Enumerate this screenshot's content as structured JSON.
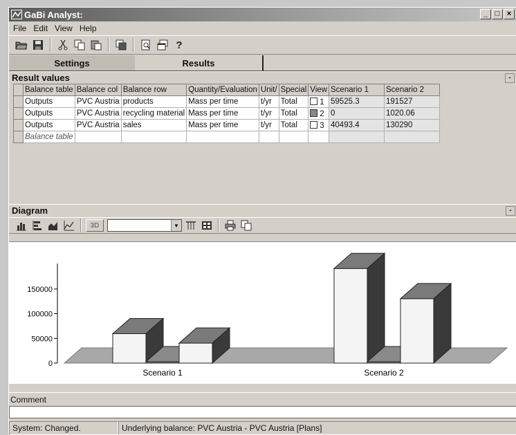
{
  "window": {
    "title": "GaBi Analyst:",
    "buttons": {
      "minimize": "_",
      "maximize": "□",
      "close": "×"
    }
  },
  "menu": {
    "items": [
      {
        "label": "File"
      },
      {
        "label": "Edit"
      },
      {
        "label": "View"
      },
      {
        "label": "Help"
      }
    ]
  },
  "toolbar": {
    "icons": [
      "open-icon",
      "save-icon",
      "cut-icon",
      "copy-icon",
      "paste-icon",
      "copy-window-icon",
      "print-preview-icon",
      "window-icon",
      "help-icon"
    ],
    "help_label": "?"
  },
  "tabs": [
    {
      "label": "Settings",
      "active": false
    },
    {
      "label": "Results",
      "active": true
    }
  ],
  "result_values": {
    "title": "Result values",
    "columns": [
      "Balance table",
      "Balance col",
      "Balance row",
      "Quantity/Evaluation",
      "Unit/",
      "Special",
      "View",
      "Scenario 1",
      "Scenario 2"
    ],
    "rows": [
      {
        "table": "Outputs",
        "col": "PVC Austria",
        "row": "products",
        "quantity": "Mass per time",
        "unit": "t/yr",
        "special": "Total",
        "view": "1",
        "view_checked": false,
        "s1": "59525.3",
        "s2": "191527"
      },
      {
        "table": "Outputs",
        "col": "PVC Austria",
        "row": "recycling material",
        "quantity": "Mass per time",
        "unit": "t/yr",
        "special": "Total",
        "view": "2",
        "view_checked": true,
        "s1": "0",
        "s2": "1020.06"
      },
      {
        "table": "Outputs",
        "col": "PVC Austria",
        "row": "sales",
        "quantity": "Mass per time",
        "unit": "t/yr",
        "special": "Total",
        "view": "3",
        "view_checked": false,
        "s1": "40493.4",
        "s2": "130290"
      }
    ],
    "placeholder_row": "Balance table"
  },
  "diagram": {
    "title": "Diagram",
    "button_3d": "3D",
    "combo_value": ""
  },
  "chart_data": {
    "type": "bar",
    "categories": [
      "Scenario 1",
      "Scenario 2"
    ],
    "series": [
      {
        "values": [
          59525.3,
          191527
        ],
        "color": "#f4f4f4"
      },
      {
        "values": [
          0,
          1020.06
        ],
        "color": "#7a7a7a"
      },
      {
        "values": [
          40493.4,
          130290
        ],
        "color": "#f4f4f4"
      }
    ],
    "yticks": [
      "0",
      "50000",
      "100000",
      "150000"
    ],
    "ylim": [
      0,
      210000
    ],
    "grid": false
  },
  "comment": {
    "label": "Comment",
    "value": ""
  },
  "status": {
    "left": "System: Changed.",
    "right": "Underlying balance: PVC Austria - PVC Austria [Plans]"
  }
}
